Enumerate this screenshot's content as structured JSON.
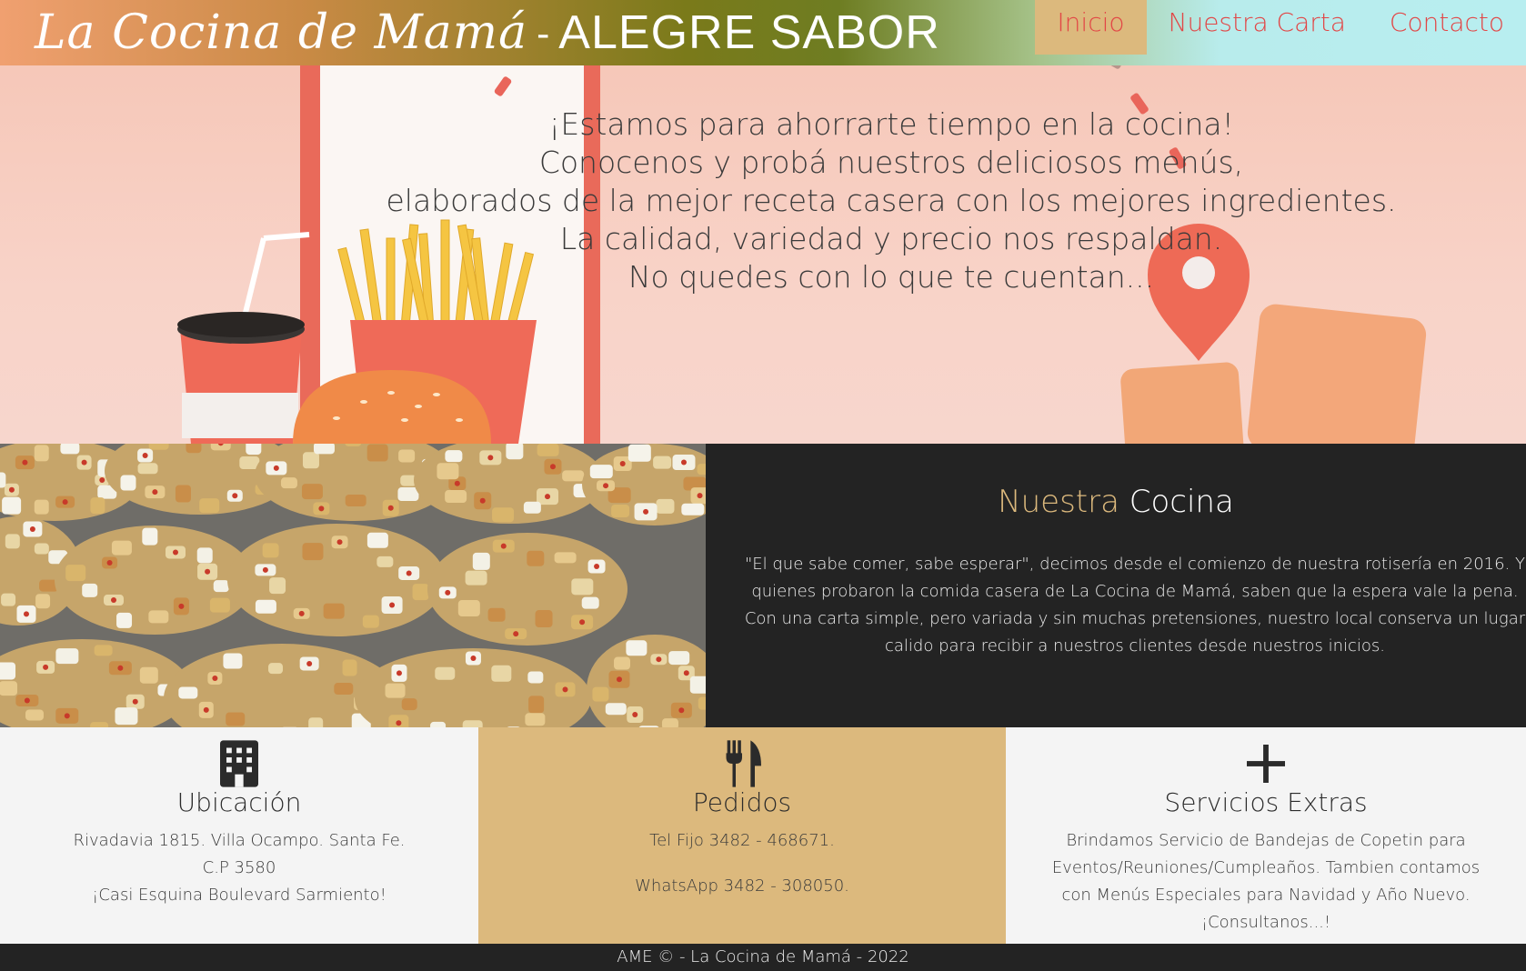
{
  "header": {
    "brand_script": "La Cocina de Mamá",
    "brand_dash": "-",
    "brand_title": "ALEGRE SABOR"
  },
  "nav": {
    "items": [
      {
        "label": "Inicio",
        "active": true
      },
      {
        "label": "Nuestra Carta",
        "active": false
      },
      {
        "label": "Contacto",
        "active": false
      }
    ]
  },
  "hero": {
    "lines": [
      "¡Estamos para ahorrarte tiempo en la cocina!",
      "Conocenos y probá nuestros deliciosos menús,",
      "elaborados de la mejor receta casera con los mejores ingredientes.",
      "La calidad, variedad y precio nos respaldan.",
      "No quedes con lo que te cuentan..."
    ]
  },
  "about": {
    "title_part1": "Nuestra",
    "title_part2": "Cocina",
    "text": "\"El que sabe comer, sabe esperar\", decimos desde el comienzo de nuestra rotisería en 2016. Y quienes probaron la comida casera de La Cocina de Mamá, saben que la espera vale la pena. Con una carta simple, pero variada y sin muchas pretensiones, nuestro local conserva un lugar calido para recibir a nuestros clientes desde nuestros inicios."
  },
  "features": {
    "location": {
      "icon": "building-icon",
      "title": "Ubicación",
      "lines": [
        "Rivadavia 1815. Villa Ocampo. Santa Fe.",
        "C.P 3580",
        "¡Casi Esquina Boulevard Sarmiento!"
      ]
    },
    "orders": {
      "icon": "fork-knife-icon",
      "title": "Pedidos",
      "phone": "Tel Fijo 3482 - 468671.",
      "whatsapp": "WhatsApp 3482 - 308050."
    },
    "extras": {
      "icon": "plus-icon",
      "title": "Servicios Extras",
      "text": "Brindamos Servicio de Bandejas de Copetin para Eventos/Reuniones/Cumpleaños. Tambien contamos con Menús Especiales para Navidad y Año Nuevo. ¡Consultanos...!"
    }
  },
  "footer": {
    "text": "AME © - La Cocina de Mamá - 2022"
  },
  "colors": {
    "accent": "#dcb97d",
    "nav_text": "#e24646",
    "dark": "#232323"
  }
}
